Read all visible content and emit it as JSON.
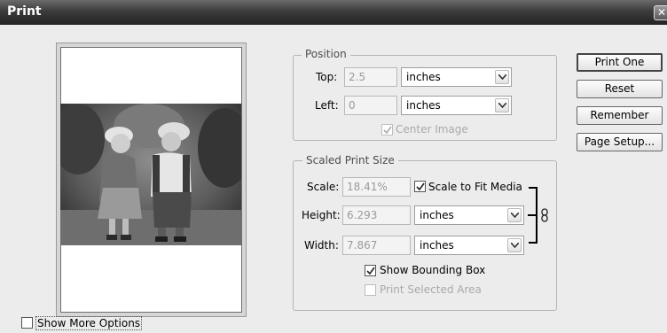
{
  "window": {
    "title": "Print",
    "close_glyph": "✕"
  },
  "position": {
    "legend": "Position",
    "top": {
      "label": "Top:",
      "value": "2.5",
      "unit": "inches"
    },
    "left": {
      "label": "Left:",
      "value": "0",
      "unit": "inches"
    },
    "center_image": {
      "label": "Center Image",
      "checked": true,
      "enabled": false
    }
  },
  "scaled": {
    "legend": "Scaled Print Size",
    "scale": {
      "label": "Scale:",
      "value": "18.41%"
    },
    "fit_media": {
      "label": "Scale to Fit Media",
      "checked": true
    },
    "height": {
      "label": "Height:",
      "value": "6.293",
      "unit": "inches"
    },
    "width": {
      "label": "Width:",
      "value": "7.867",
      "unit": "inches"
    },
    "bounding_box": {
      "label": "Show Bounding Box",
      "checked": true
    },
    "selected_area": {
      "label": "Print Selected Area",
      "checked": false,
      "enabled": false
    }
  },
  "buttons": {
    "print_one": "Print One",
    "reset": "Reset",
    "remember": "Remember",
    "page_setup": "Page Setup..."
  },
  "more_options": {
    "label": "Show More Options",
    "checked": false
  },
  "icons": {
    "close": "close-icon",
    "dropdown": "chevron-down-icon",
    "check": "checkmark-icon",
    "link": "chain-link-icon"
  },
  "colors": {
    "titlebar": "#3c3c3c",
    "dialog_bg": "#ececec",
    "disabled_text": "#a9a9a9"
  }
}
